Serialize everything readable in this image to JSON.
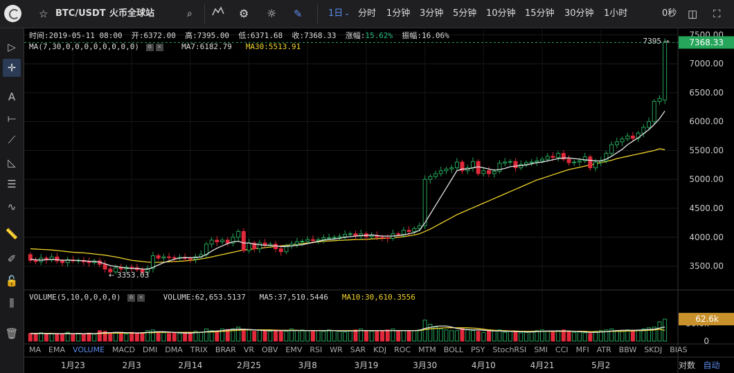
{
  "header": {
    "symbol": "BTC/USDT",
    "exchange": "火币全球站",
    "intervals": [
      "1日",
      "分时",
      "1分钟",
      "3分钟",
      "5分钟",
      "10分钟",
      "15分钟",
      "30分钟",
      "1小时"
    ],
    "selected_interval": "1日",
    "countdown": "0秒"
  },
  "ohlc": {
    "time_label": "时间:2019-05-11 08:00",
    "open_label": "开:6372.00",
    "high_label": "高:7395.00",
    "low_label": "低:6371.68",
    "close_label": "收:7368.33",
    "change_prefix": "涨幅:",
    "change_value": "15.62%",
    "amplitude_label": "振幅:16.06%"
  },
  "ma_legend": {
    "params": "MA(7,30,0,0,0,0,0,0,0,0)",
    "ma7": "MA7:6182.79",
    "ma30": "MA30:5513.91"
  },
  "vol_legend": {
    "params": "VOLUME(5,10,0,0,0,0)",
    "volume": "VOLUME:62,653.5137",
    "ma5": "MA5:37,510.5446",
    "ma10": "MA10:30,610.3556"
  },
  "indicators": [
    "MA",
    "EMA",
    "VOLUME",
    "MACD",
    "DMI",
    "DMA",
    "TRIX",
    "BRAR",
    "VR",
    "OBV",
    "EMV",
    "RSI",
    "WR",
    "SAR",
    "KDJ",
    "ROC",
    "MTM",
    "BOLL",
    "PSY",
    "StochRSI",
    "SMI",
    "CCI",
    "MFI",
    "ATR",
    "BBW",
    "SKDJ",
    "BIAS"
  ],
  "selected_indicator": "VOLUME",
  "footer": {
    "log_label": "对数",
    "auto_label": "自动"
  },
  "colors": {
    "up": "#26a65b",
    "down": "#e0293b",
    "ma7": "#e8e8e8",
    "ma30": "#f2d42a",
    "ma10_vol": "#f2d42a",
    "ma5_vol": "#e8e8e8",
    "accent": "#5b8dee",
    "price_tag": "#26a65b",
    "vol_tag": "#c8912b"
  },
  "icons": [
    "star-icon",
    "search-icon",
    "candle-chart-icon",
    "gear-icon",
    "sun-icon",
    "pen-icon",
    "camera-icon",
    "fullscreen-icon",
    "cursor-icon",
    "crosshair-icon",
    "text-icon",
    "line-icon",
    "trend-icon",
    "ruler-icon",
    "pencil-icon",
    "lock-icon",
    "trash-icon"
  ],
  "chart_data": [
    {
      "type": "candlestick",
      "ylim": [
        3100,
        7600
      ],
      "price_ticks": [
        "7500.00",
        "7000.00",
        "6500.00",
        "6000.00",
        "5500.00",
        "5000.00",
        "4500.00",
        "4000.00",
        "3500.00"
      ],
      "price_tick_values": [
        7500,
        7000,
        6500,
        6000,
        5500,
        5000,
        4500,
        4000,
        3500
      ],
      "last_price": "7368.33",
      "last_price_value": 7368.33,
      "high_marker": "7395",
      "high_marker_value": 7395,
      "low_marker": "3353.03",
      "low_marker_value": 3353.03,
      "x_labels": [
        "1月23",
        "2月3",
        "2月14",
        "2月25",
        "3月8",
        "3月19",
        "3月30",
        "4月10",
        "4月21",
        "5月2"
      ],
      "x_label_indices": [
        8,
        19,
        30,
        41,
        52,
        63,
        74,
        85,
        96,
        107
      ],
      "closes": [
        3600,
        3580,
        3640,
        3610,
        3660,
        3590,
        3560,
        3610,
        3590,
        3600,
        3575,
        3560,
        3590,
        3530,
        3450,
        3400,
        3470,
        3450,
        3480,
        3470,
        3440,
        3400,
        3460,
        3680,
        3640,
        3660,
        3650,
        3640,
        3650,
        3630,
        3620,
        3660,
        3700,
        3880,
        3950,
        3920,
        3950,
        3900,
        4000,
        4100,
        3770,
        3900,
        3800,
        3900,
        3860,
        3880,
        3800,
        3750,
        3850,
        3880,
        3920,
        3930,
        3960,
        3940,
        3960,
        3990,
        3990,
        4000,
        4010,
        4050,
        4060,
        4020,
        4060,
        4010,
        4030,
        4000,
        3990,
        3980,
        4060,
        4050,
        4120,
        4100,
        4150,
        4200,
        5000,
        5050,
        5100,
        5150,
        5180,
        5200,
        5300,
        5150,
        5200,
        5310,
        5100,
        5150,
        5100,
        5140,
        5280,
        5300,
        5310,
        5200,
        5260,
        5290,
        5300,
        5320,
        5350,
        5400,
        5380,
        5450,
        5350,
        5290,
        5300,
        5320,
        5390,
        5200,
        5300,
        5320,
        5450,
        5600,
        5650,
        5700,
        5750,
        5710,
        5800,
        5900,
        6000,
        6350,
        6400,
        7368
      ],
      "opens": [
        3700,
        3600,
        3580,
        3640,
        3610,
        3660,
        3590,
        3560,
        3610,
        3590,
        3600,
        3575,
        3560,
        3590,
        3530,
        3450,
        3400,
        3470,
        3450,
        3480,
        3470,
        3440,
        3400,
        3460,
        3680,
        3640,
        3660,
        3650,
        3640,
        3650,
        3630,
        3620,
        3660,
        3700,
        3880,
        3950,
        3920,
        3950,
        3900,
        4000,
        4100,
        3770,
        3900,
        3800,
        3900,
        3860,
        3880,
        3800,
        3750,
        3850,
        3880,
        3920,
        3930,
        3960,
        3940,
        3960,
        3990,
        3990,
        4000,
        4010,
        4050,
        4060,
        4020,
        4060,
        4010,
        4030,
        4000,
        3990,
        3980,
        4060,
        4050,
        4120,
        4100,
        4150,
        4200,
        5000,
        5050,
        5100,
        5150,
        5180,
        5200,
        5300,
        5150,
        5200,
        5310,
        5100,
        5150,
        5100,
        5140,
        5280,
        5300,
        5310,
        5200,
        5260,
        5290,
        5300,
        5320,
        5350,
        5400,
        5380,
        5450,
        5350,
        5290,
        5300,
        5320,
        5390,
        5200,
        5300,
        5320,
        5450,
        5600,
        5650,
        5700,
        5750,
        5710,
        5800,
        5900,
        6000,
        6350,
        6372
      ],
      "ma7_values": [
        3620,
        3610,
        3605,
        3610,
        3615,
        3612,
        3600,
        3605,
        3600,
        3598,
        3592,
        3585,
        3580,
        3570,
        3540,
        3510,
        3495,
        3480,
        3470,
        3460,
        3460,
        3450,
        3445,
        3480,
        3520,
        3560,
        3590,
        3620,
        3640,
        3650,
        3645,
        3650,
        3660,
        3700,
        3760,
        3810,
        3850,
        3890,
        3920,
        3930,
        3900,
        3900,
        3880,
        3870,
        3860,
        3860,
        3850,
        3840,
        3840,
        3850,
        3860,
        3870,
        3890,
        3910,
        3930,
        3950,
        3960,
        3970,
        3980,
        4000,
        4010,
        4020,
        4030,
        4030,
        4040,
        4030,
        4020,
        4020,
        4020,
        4030,
        4040,
        4060,
        4080,
        4120,
        4250,
        4400,
        4550,
        4700,
        4850,
        5000,
        5150,
        5180,
        5180,
        5200,
        5220,
        5200,
        5180,
        5160,
        5170,
        5190,
        5220,
        5230,
        5240,
        5250,
        5270,
        5290,
        5300,
        5320,
        5340,
        5360,
        5370,
        5370,
        5360,
        5350,
        5340,
        5330,
        5320,
        5320,
        5350,
        5400,
        5460,
        5520,
        5600,
        5660,
        5720,
        5790,
        5860,
        5950,
        6050,
        6182.79
      ],
      "ma30_values": [
        3800,
        3795,
        3790,
        3785,
        3780,
        3770,
        3760,
        3750,
        3740,
        3735,
        3730,
        3720,
        3710,
        3700,
        3690,
        3675,
        3660,
        3640,
        3620,
        3600,
        3590,
        3580,
        3570,
        3565,
        3565,
        3570,
        3575,
        3580,
        3585,
        3590,
        3600,
        3610,
        3625,
        3640,
        3660,
        3680,
        3700,
        3720,
        3740,
        3760,
        3780,
        3790,
        3800,
        3810,
        3820,
        3830,
        3840,
        3850,
        3860,
        3870,
        3880,
        3890,
        3900,
        3910,
        3920,
        3930,
        3935,
        3940,
        3945,
        3950,
        3955,
        3960,
        3960,
        3965,
        3970,
        3975,
        3980,
        3985,
        3990,
        4000,
        4010,
        4025,
        4040,
        4060,
        4100,
        4140,
        4190,
        4240,
        4290,
        4340,
        4390,
        4430,
        4470,
        4510,
        4550,
        4590,
        4630,
        4670,
        4710,
        4750,
        4790,
        4830,
        4870,
        4910,
        4950,
        4990,
        5020,
        5050,
        5080,
        5110,
        5140,
        5170,
        5190,
        5210,
        5230,
        5250,
        5270,
        5290,
        5310,
        5330,
        5360,
        5380,
        5400,
        5420,
        5440,
        5460,
        5480,
        5500,
        5530,
        5513.91
      ]
    },
    {
      "type": "bar",
      "name": "VOLUME",
      "ylim": [
        0,
        110
      ],
      "vol_ticks": [
        "50.0k",
        "0"
      ],
      "vol_tick_values": [
        50,
        0
      ],
      "last_volume": "62.6k",
      "last_volume_value": 62.65,
      "volumes": [
        22,
        20,
        24,
        20,
        21,
        22,
        19,
        25,
        20,
        22,
        21,
        23,
        20,
        30,
        28,
        22,
        25,
        23,
        20,
        25,
        24,
        23,
        30,
        32,
        25,
        24,
        22,
        23,
        22,
        25,
        24,
        28,
        26,
        35,
        30,
        28,
        35,
        33,
        35,
        40,
        30,
        32,
        28,
        32,
        30,
        28,
        32,
        30,
        28,
        35,
        30,
        32,
        30,
        28,
        30,
        28,
        32,
        30,
        28,
        26,
        30,
        32,
        35,
        30,
        28,
        28,
        30,
        32,
        35,
        30,
        30,
        28,
        30,
        32,
        60,
        48,
        40,
        35,
        32,
        30,
        30,
        38,
        32,
        30,
        28,
        25,
        28,
        30,
        32,
        25,
        28,
        26,
        24,
        25,
        28,
        30,
        32,
        28,
        26,
        30,
        32,
        28,
        25,
        26,
        24,
        22,
        28,
        30,
        32,
        35,
        30,
        28,
        32,
        30,
        32,
        35,
        38,
        40,
        55,
        62.6
      ],
      "ma5_values": [
        22,
        21,
        22,
        21,
        21,
        21,
        21,
        22,
        21,
        22,
        21,
        22,
        21,
        23,
        24,
        24,
        25,
        25,
        24,
        24,
        23,
        24,
        25,
        26,
        27,
        27,
        26,
        25,
        24,
        23,
        23,
        24,
        25,
        27,
        28,
        29,
        30,
        32,
        33,
        34,
        34,
        33,
        32,
        31,
        30,
        30,
        30,
        30,
        30,
        30,
        30,
        30,
        30,
        30,
        30,
        30,
        30,
        30,
        29,
        29,
        29,
        29,
        30,
        30,
        30,
        30,
        30,
        30,
        30,
        30,
        30,
        30,
        30,
        31,
        36,
        39,
        42,
        43,
        43,
        40,
        36,
        34,
        33,
        32,
        32,
        31,
        30,
        29,
        29,
        28,
        28,
        27,
        27,
        26,
        26,
        27,
        28,
        29,
        29,
        29,
        29,
        29,
        28,
        27,
        26,
        25,
        25,
        26,
        27,
        29,
        30,
        31,
        31,
        31,
        31,
        32,
        33,
        34,
        37,
        40
      ],
      "ma10_values": [
        22,
        22,
        22,
        22,
        22,
        21,
        21,
        21,
        21,
        21,
        21,
        21,
        21,
        22,
        22,
        23,
        23,
        23,
        23,
        23,
        23,
        23,
        24,
        24,
        25,
        25,
        25,
        25,
        25,
        25,
        25,
        25,
        25,
        26,
        26,
        27,
        28,
        29,
        30,
        31,
        32,
        32,
        32,
        32,
        32,
        32,
        31,
        31,
        31,
        31,
        31,
        30,
        30,
        30,
        30,
        30,
        30,
        30,
        30,
        30,
        30,
        30,
        30,
        30,
        30,
        30,
        30,
        30,
        30,
        30,
        30,
        30,
        30,
        30,
        33,
        35,
        36,
        37,
        38,
        38,
        38,
        38,
        38,
        37,
        36,
        34,
        32,
        31,
        30,
        30,
        29,
        29,
        28,
        28,
        28,
        28,
        28,
        28,
        28,
        28,
        28,
        28,
        28,
        28,
        28,
        27,
        27,
        27,
        27,
        28,
        28,
        28,
        29,
        29,
        30,
        30,
        31,
        32,
        34,
        30.61
      ]
    }
  ]
}
